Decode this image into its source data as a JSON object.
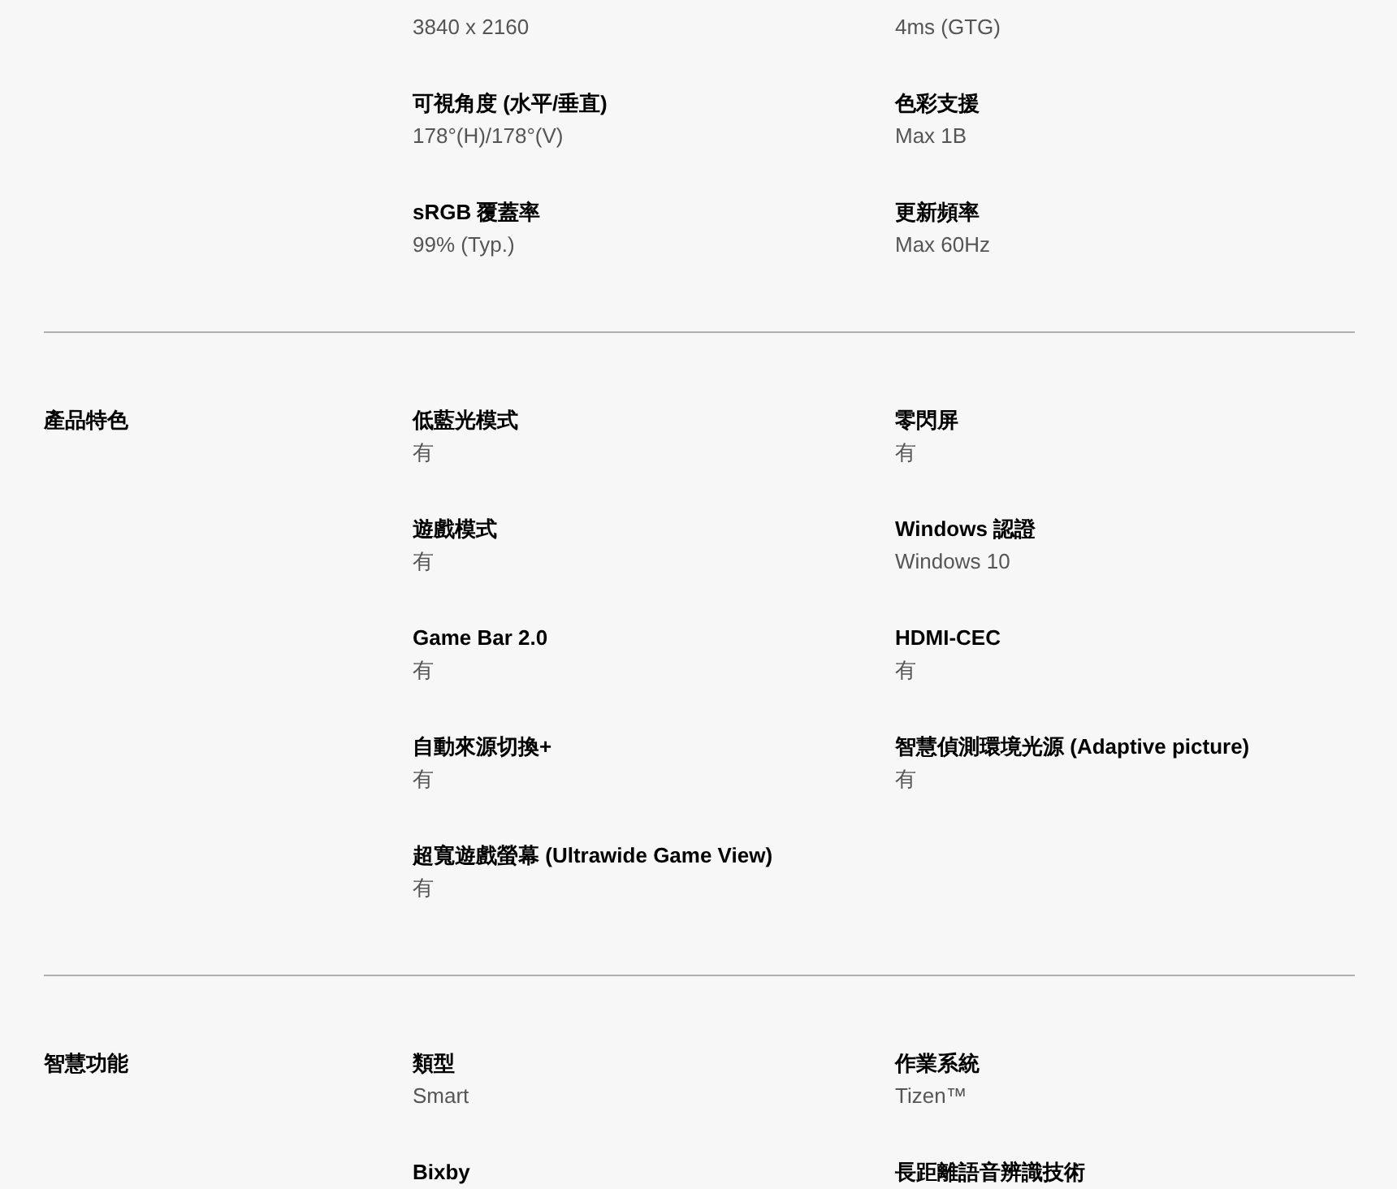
{
  "sections": [
    {
      "specs": [
        {
          "value": "3840 x 2160"
        },
        {
          "value": "4ms (GTG)"
        },
        {
          "label": "可視角度 (水平/垂直)",
          "value": "178°(H)/178°(V)"
        },
        {
          "label": "色彩支援",
          "value": "Max 1B"
        },
        {
          "label": "sRGB 覆蓋率",
          "value": "99% (Typ.)"
        },
        {
          "label": "更新頻率",
          "value": "Max 60Hz"
        }
      ]
    },
    {
      "category": "產品特色",
      "specs": [
        {
          "label": "低藍光模式",
          "value": "有"
        },
        {
          "label": "零閃屏",
          "value": "有"
        },
        {
          "label": "遊戲模式",
          "value": "有"
        },
        {
          "label": "Windows 認證",
          "value": "Windows 10"
        },
        {
          "label": "Game Bar 2.0",
          "value": "有"
        },
        {
          "label": "HDMI-CEC",
          "value": "有"
        },
        {
          "label": "自動來源切換+",
          "value": "有"
        },
        {
          "label": "智慧偵測環境光源 (Adaptive picture)",
          "value": "有"
        },
        {
          "label": "超寬遊戲螢幕 (Ultrawide Game View)",
          "value": "有"
        }
      ]
    },
    {
      "category": "智慧功能",
      "specs": [
        {
          "label": "類型",
          "value": "Smart"
        },
        {
          "label": "作業系統",
          "value": "Tizen™"
        },
        {
          "label": "Bixby"
        },
        {
          "label": "長距離語音辨識技術"
        }
      ]
    }
  ]
}
